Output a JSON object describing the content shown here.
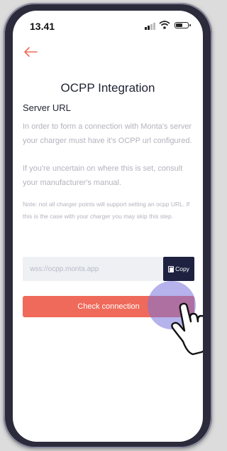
{
  "status_bar": {
    "time": "13.41",
    "icons": [
      "signal-icon",
      "wifi-icon",
      "battery-icon"
    ]
  },
  "nav": {
    "back_icon": "arrow-left-icon"
  },
  "page": {
    "title": "OCPP Integration",
    "section_title": "Server URL",
    "paragraph1": "In order to form a connection with Monta's server your charger must have it's OCPP url configured.",
    "paragraph2": "If you're uncertain on where this is set, consult your manufacturer's manual.",
    "note": "Note: not all charger points will support setting an ocpp URL. If this is the case with your charger you may skip this step."
  },
  "url_field": {
    "value": "wss://ocpp.monta.app",
    "copy_label": "Copy",
    "copy_icon": "copy-icon"
  },
  "actions": {
    "check_label": "Check connection"
  },
  "overlay": {
    "pointer_icon": "hand-pointer-icon",
    "touch_color": "#7873dc"
  },
  "colors": {
    "accent": "#ef6a5a",
    "dark": "#1e2140",
    "muted_text": "#b3b3be"
  }
}
